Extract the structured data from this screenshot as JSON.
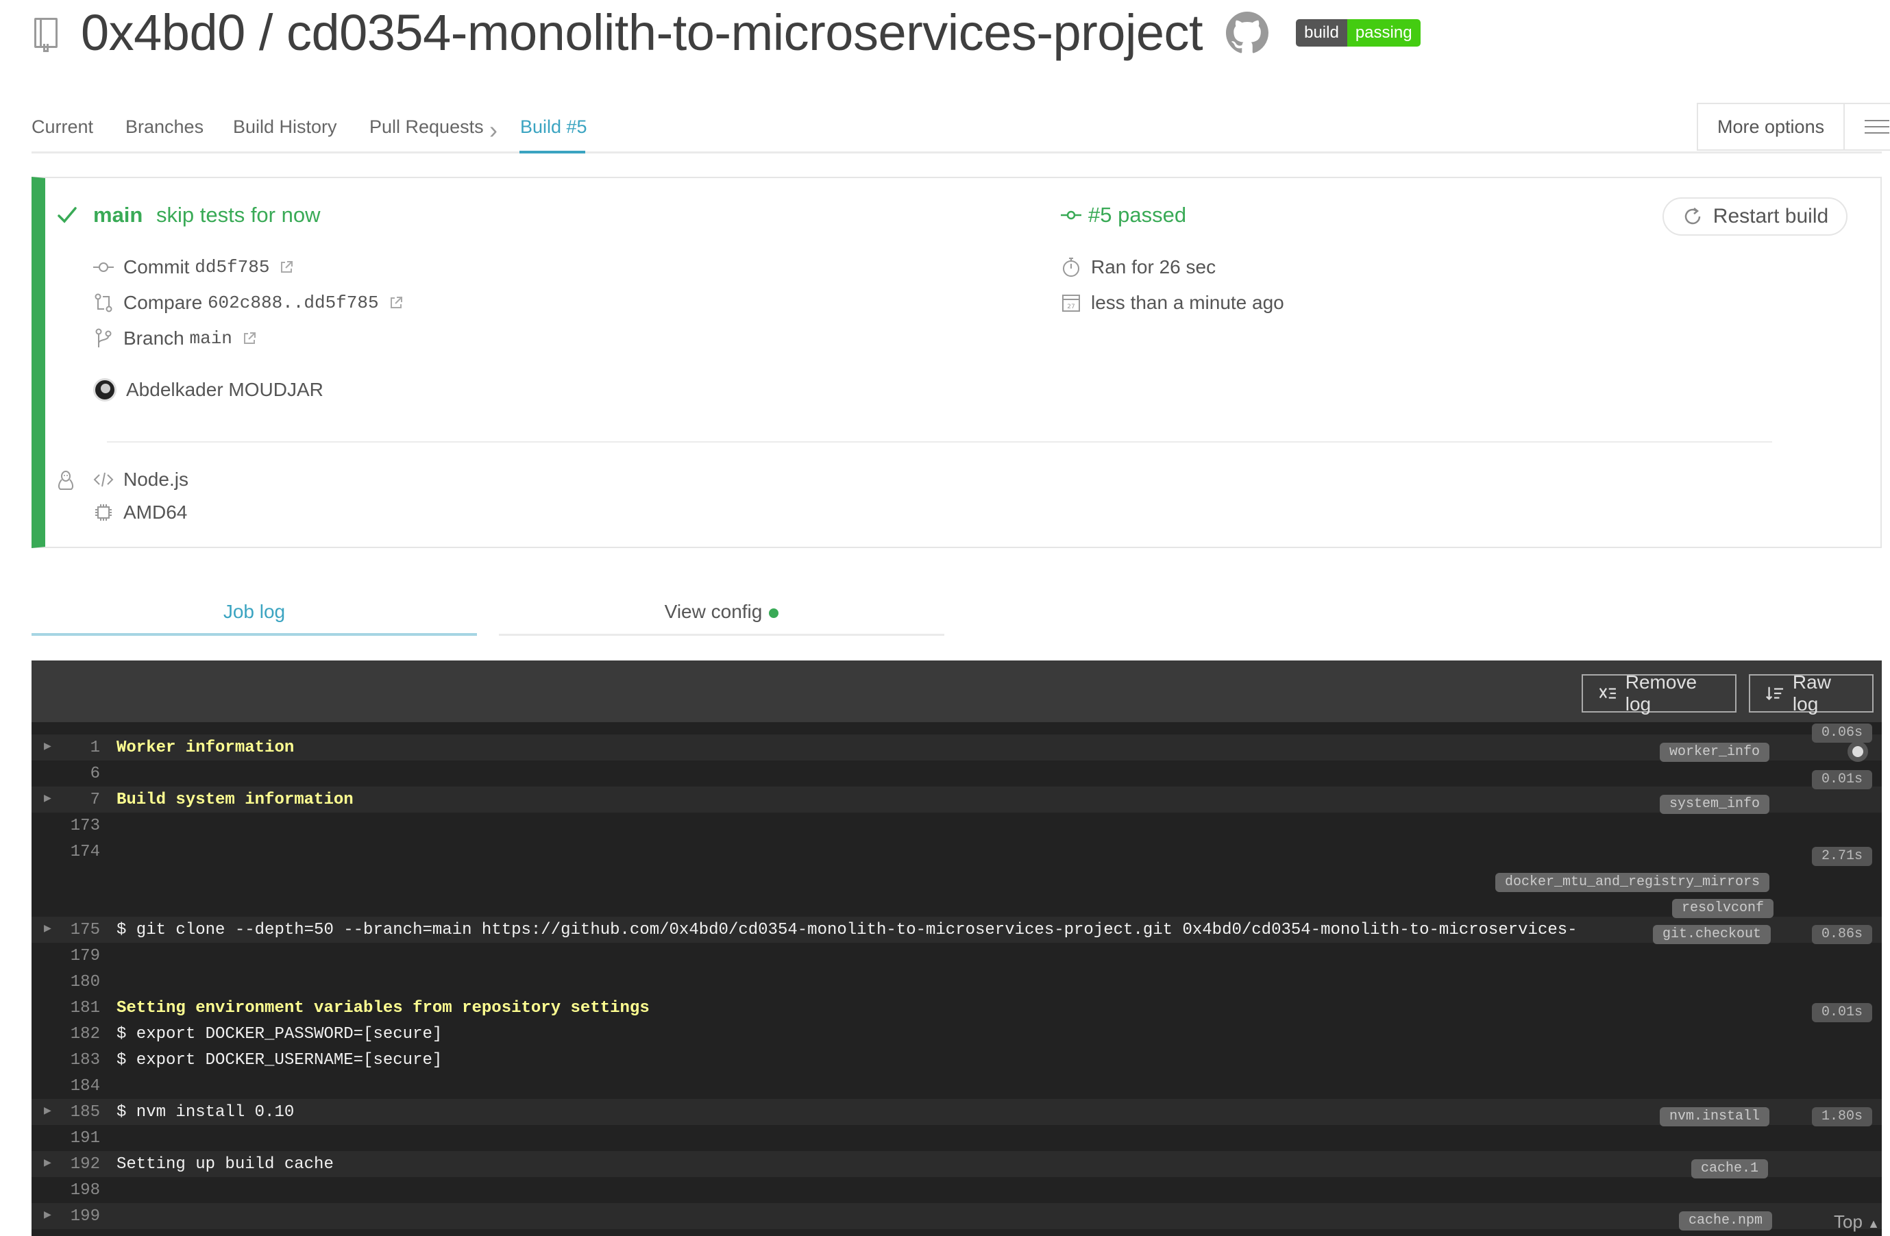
{
  "header": {
    "repo_title": "0x4bd0 / cd0354-monolith-to-microservices-project",
    "badge_left": "build",
    "badge_right": "passing"
  },
  "nav": {
    "items": [
      "Current",
      "Branches",
      "Build History",
      "Pull Requests",
      "Build #5"
    ],
    "more_options": "More options"
  },
  "build": {
    "branch": "main",
    "message": "skip tests for now",
    "commit_label": "Commit",
    "commit_hash": "dd5f785",
    "compare_label": "Compare",
    "compare_range": "602c888..dd5f785",
    "branch_label": "Branch",
    "branch_value": "main",
    "author": "Abdelkader MOUDJAR",
    "language": "Node.js",
    "arch": "AMD64",
    "status": "#5 passed",
    "duration": "Ran for 26 sec",
    "finished": "less than a minute ago",
    "restart_label": "Restart build",
    "calendar_day": "27"
  },
  "log_tabs": {
    "job_log": "Job log",
    "view_config": "View config"
  },
  "log": {
    "remove_log": "Remove log",
    "raw_log": "Raw log",
    "top_label": "Top",
    "lines": [
      {
        "num": "1",
        "text": "Worker information",
        "style": "yellow",
        "fold": true
      },
      {
        "num": "6",
        "text": "",
        "style": "",
        "fold": false
      },
      {
        "num": "7",
        "text": "Build system information",
        "style": "yellow",
        "fold": true
      },
      {
        "num": "173",
        "text": "",
        "style": "",
        "fold": false
      },
      {
        "num": "174",
        "text": "",
        "style": "",
        "fold": false
      },
      {
        "num": "175",
        "text": "$ git clone --depth=50 --branch=main https://github.com/0x4bd0/cd0354-monolith-to-microservices-project.git 0x4bd0/cd0354-monolith-to-microservices-",
        "style": "",
        "fold": true
      },
      {
        "num": "179",
        "text": "",
        "style": "",
        "fold": false
      },
      {
        "num": "180",
        "text": "",
        "style": "",
        "fold": false
      },
      {
        "num": "181",
        "text": "Setting environment variables from repository settings",
        "style": "yellow",
        "fold": false
      },
      {
        "num": "182",
        "text": "$ export DOCKER_PASSWORD=[secure]",
        "style": "",
        "fold": false
      },
      {
        "num": "183",
        "text": "$ export DOCKER_USERNAME=[secure]",
        "style": "",
        "fold": false
      },
      {
        "num": "184",
        "text": "",
        "style": "",
        "fold": false
      },
      {
        "num": "185",
        "text": "$ nvm install 0.10",
        "style": "",
        "fold": true
      },
      {
        "num": "191",
        "text": "",
        "style": "",
        "fold": false
      },
      {
        "num": "192",
        "text": "Setting up build cache",
        "style": "",
        "fold": true
      },
      {
        "num": "198",
        "text": "",
        "style": "",
        "fold": false
      },
      {
        "num": "199",
        "text": "",
        "style": "",
        "fold": true
      }
    ],
    "tags": {
      "worker_info": "worker_info",
      "system_info": "system_info",
      "docker_mirrors": "docker_mtu_and_registry_mirrors",
      "resolvconf": "resolvconf",
      "git_checkout": "git.checkout",
      "nvm_install": "nvm.install",
      "cache_1": "cache.1",
      "cache_npm": "cache.npm"
    },
    "times": {
      "t1": "0.06s",
      "t2": "0.01s",
      "t3": "2.71s",
      "t4": "0.86s",
      "t5": "0.01s",
      "t6": "1.80s"
    }
  }
}
